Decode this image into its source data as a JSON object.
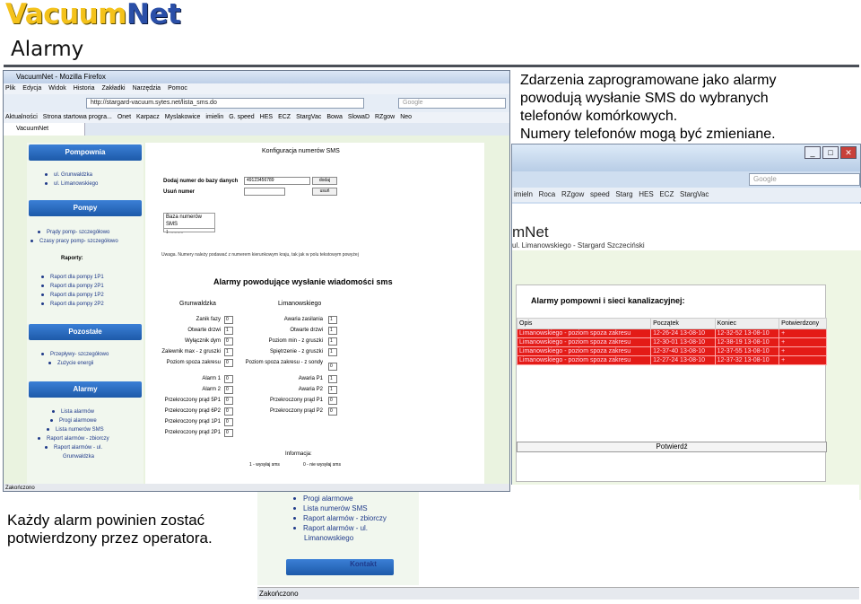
{
  "header": {
    "logo_part1": "Vacuum",
    "logo_part2": "Net",
    "title": "Alarmy"
  },
  "notes": {
    "top_right": [
      "Zdarzenia zaprogramowane jako alarmy",
      "powodują wysłanie SMS do wybranych",
      "telefonów komórkowych.",
      "Numery telefonów mogą być zmieniane."
    ],
    "bottom_left": [
      "Każdy alarm powinien zostać",
      "potwierdzony przez operatora."
    ]
  },
  "browser": {
    "window_title": "VacuumNet - Mozilla Firefox",
    "menu": [
      "Plik",
      "Edycja",
      "Widok",
      "Historia",
      "Zakładki",
      "Narzędzia",
      "Pomoc"
    ],
    "url": "http://stargard-vacuum.sytes.net/lista_sms.do",
    "search_placeholder": "Google",
    "bookmarks": [
      "Aktualności",
      "Strona startowa progra...",
      "Onet",
      "Karpacz",
      "Myslakowice",
      "imielin",
      "G. speed",
      "HES",
      "ECZ",
      "StargVac",
      "Bowa",
      "SlowaD",
      "RZgow",
      "Neo"
    ],
    "tab": "VacuumNet",
    "status": "Zakończono"
  },
  "sidebar": {
    "pompownia_btn": "Pompownia",
    "pompownia_links": [
      "ul. Grunwaldzka",
      "ul. Limanowskiego"
    ],
    "pompy_btn": "Pompy",
    "pompy_links": [
      "Prądy pomp- szczegółowo",
      "Czasy pracy pomp- szczegółowo"
    ],
    "raporty_label": "Raporty:",
    "raporty_links": [
      "Raport dla pompy 1P1",
      "Raport dla pompy 2P1",
      "Raport dla pompy 1P2",
      "Raport dla pompy 2P2"
    ],
    "pozostale_btn": "Pozostałe",
    "pozostale_links": [
      "Przepływy- szczegółowo",
      "Zużycie energii"
    ],
    "alarmy_btn": "Alarmy",
    "alarmy_links": [
      "Lista alarmów",
      "Progi alarmowe",
      "Lista numerów SMS",
      "Raport alarmów - zbiorczy",
      "Raport alarmów - ul.",
      "Grunwaldzka"
    ]
  },
  "config": {
    "title": "Konfiguracja numerów SMS",
    "add_label": "Dodaj numer do bazy danych",
    "add_value": "49123456789",
    "add_button": "dodaj",
    "remove_label": "Usuń numer",
    "remove_button": "usuń",
    "db_title": "Baza numerów SMS",
    "db_row": "1  ...........",
    "note": "Uwaga. Numery należy podawać z numerem kierunkowym kraju, tak jak w polu tekstowym powyżej"
  },
  "alarms": {
    "heading": "Alarmy powodujące wysłanie wiadomości sms",
    "col1": "Grunwaldzka",
    "col2": "Limanowskiego",
    "left": [
      {
        "label": "Zanik fazy",
        "value": "0"
      },
      {
        "label": "Otwarte drzwi",
        "value": "1"
      },
      {
        "label": "Wyłącznik dym",
        "value": "0"
      },
      {
        "label": "Zalewnik max - z gruszki",
        "value": "1"
      },
      {
        "label": "Poziom spoza zakresu",
        "value": "0"
      },
      {
        "label": "Alarm 1",
        "value": "0"
      },
      {
        "label": "Alarm 2",
        "value": "0"
      },
      {
        "label": "Przekroczony prąd 5P1",
        "value": "0"
      },
      {
        "label": "Przekroczony prąd 6P2",
        "value": "0"
      },
      {
        "label": "Przekroczony prąd 1P1",
        "value": "0"
      },
      {
        "label": "Przekroczony prąd 2P1",
        "value": "0"
      }
    ],
    "right": [
      {
        "label": "Awaria zasilania",
        "value": "1"
      },
      {
        "label": "Otwarte drzwi",
        "value": "1"
      },
      {
        "label": "Poziom min - z gruszki",
        "value": "1"
      },
      {
        "label": "Spiętrzenie - z gruszki",
        "value": "1"
      },
      {
        "label": "Poziom spoza zakresu - z sondy",
        "value": "0"
      },
      {
        "label": "Awaria P1",
        "value": "1"
      },
      {
        "label": "Awaria P2",
        "value": "1"
      },
      {
        "label": "Przekroczony prąd P1",
        "value": "0"
      },
      {
        "label": "Przekroczony prąd P2",
        "value": "0"
      }
    ],
    "info_label": "Informacja:",
    "legend1": "1 - wysyłaj sms",
    "legend2": "0 - nie wysyłaj sms"
  },
  "browser2": {
    "search_placeholder": "Google",
    "bookmarks": [
      "imieln",
      "Roca",
      "RZgow",
      "speed",
      "Starg",
      "HES",
      "ECZ",
      "StargVac"
    ],
    "logo": "mNet",
    "subtitle": "ul. Limanowskiego - Stargard Szczeciński",
    "heading": "Alarmy pompowni i sieci kanalizacyjnej:",
    "columns": [
      "Opis",
      "Początek",
      "Koniec",
      "Potwierdzony"
    ],
    "rows": [
      [
        "Limanowskiego - poziom spoza zakresu",
        "12-26-24 13-08-10",
        "12-32-52 13-08-10",
        "+"
      ],
      [
        "Limanowskiego - poziom spoza zakresu",
        "12-30-01 13-08-10",
        "12-38-19 13-08-10",
        "+"
      ],
      [
        "Limanowskiego - poziom spoza zakresu",
        "12-37-40 13-08-10",
        "12-37-55 13-08-10",
        "+"
      ],
      [
        "Limanowskiego - poziom spoza zakresu",
        "12-27-24 13-08-10",
        "12-37-32 13-08-10",
        "+"
      ]
    ],
    "confirm_button": "Potwierdź"
  },
  "inset": {
    "links": [
      "Progi alarmowe",
      "Lista numerów SMS",
      "Raport alarmów - zbiorczy",
      "Raport alarmów - ul.",
      "Limanowskiego"
    ],
    "contact_button": "Kontakt",
    "status": "Zakończono"
  }
}
